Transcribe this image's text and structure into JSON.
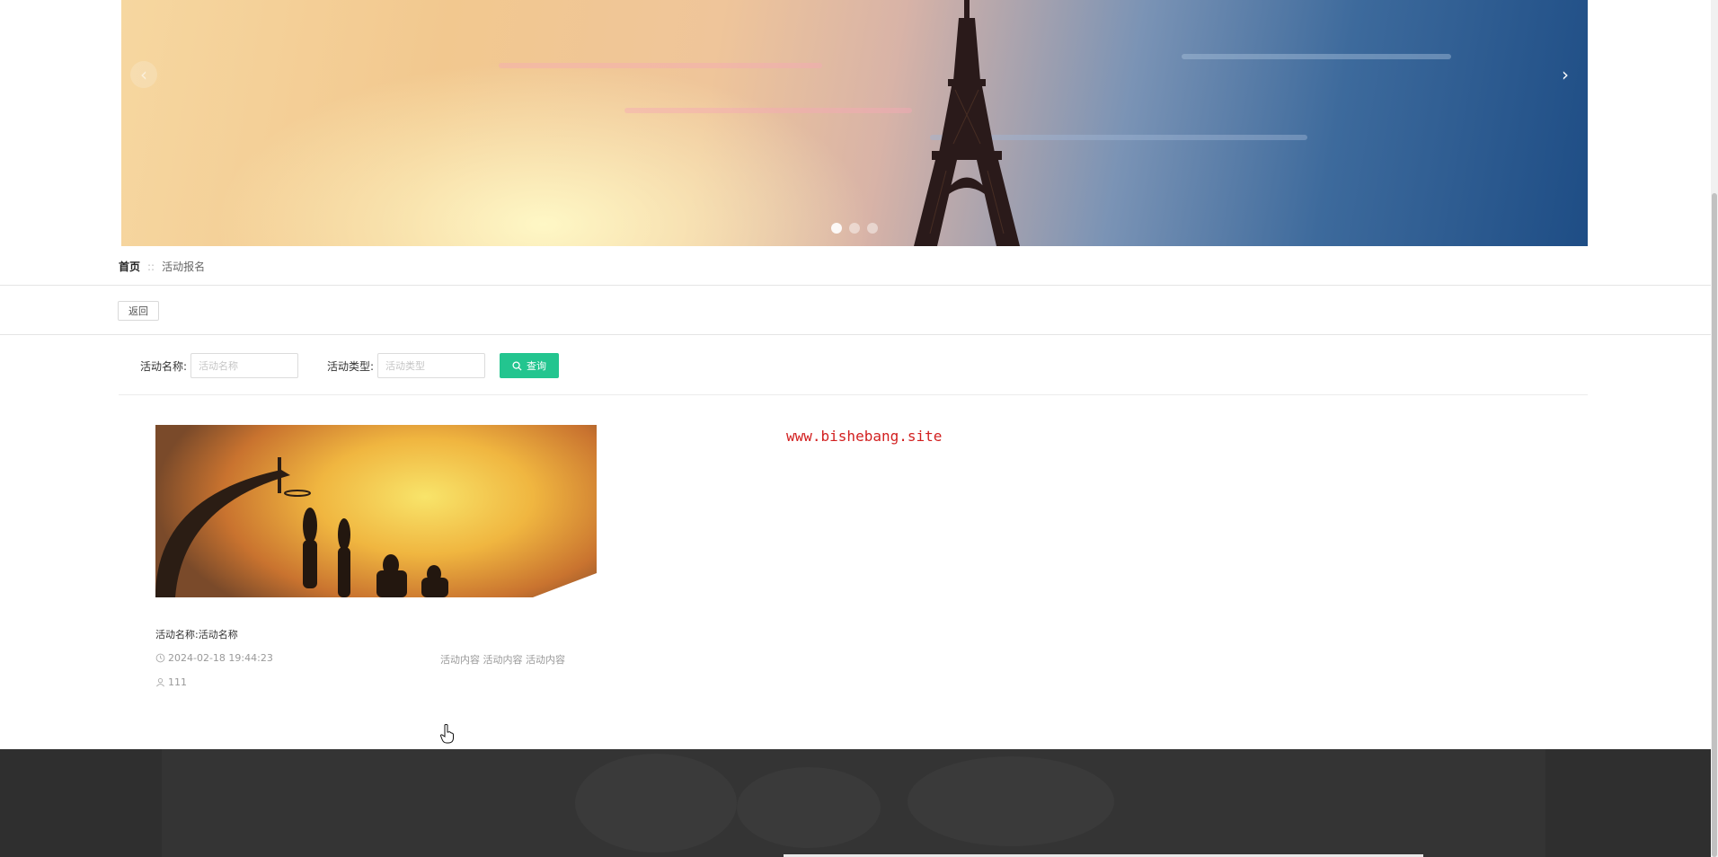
{
  "banner": {
    "prev_icon": "chevron-left-icon",
    "next_icon": "chevron-right-icon",
    "prev_glyph": "‹",
    "next_glyph": "›",
    "dots": 3,
    "active_dot": 1
  },
  "breadcrumb": {
    "home": "首页",
    "separator": "::",
    "current": "活动报名"
  },
  "back_button": {
    "label": "返回"
  },
  "search": {
    "name_label": "活动名称:",
    "name_placeholder": "活动名称",
    "type_label": "活动类型:",
    "type_placeholder": "活动类型",
    "button_label": "查询",
    "button_icon": "search-icon",
    "accent_color": "#23c58f"
  },
  "activities": [
    {
      "title": "活动名称:活动名称",
      "time": "2024-02-18 19:44:23",
      "content": "活动内容 活动内容 活动内容",
      "count": "111",
      "time_icon": "clock-icon",
      "count_icon": "user-icon"
    }
  ],
  "watermark": "www.bishebang.site",
  "watermark_color": "#d21f1f"
}
